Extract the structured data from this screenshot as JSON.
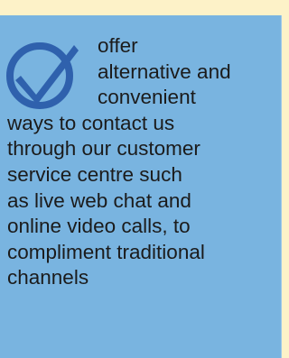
{
  "card": {
    "icon": "checkmark-circle-icon",
    "colors": {
      "page_background": "#fdf2c8",
      "card_background": "#79b4e0",
      "icon_blue": "#2f61ad",
      "text": "#1b1b1b"
    },
    "lines": [
      "offer",
      "alternative and",
      "convenient",
      "ways to contact us",
      "through our customer",
      "service centre such",
      "as live web chat and",
      "online video calls, to",
      "compliment traditional",
      "channels"
    ]
  }
}
